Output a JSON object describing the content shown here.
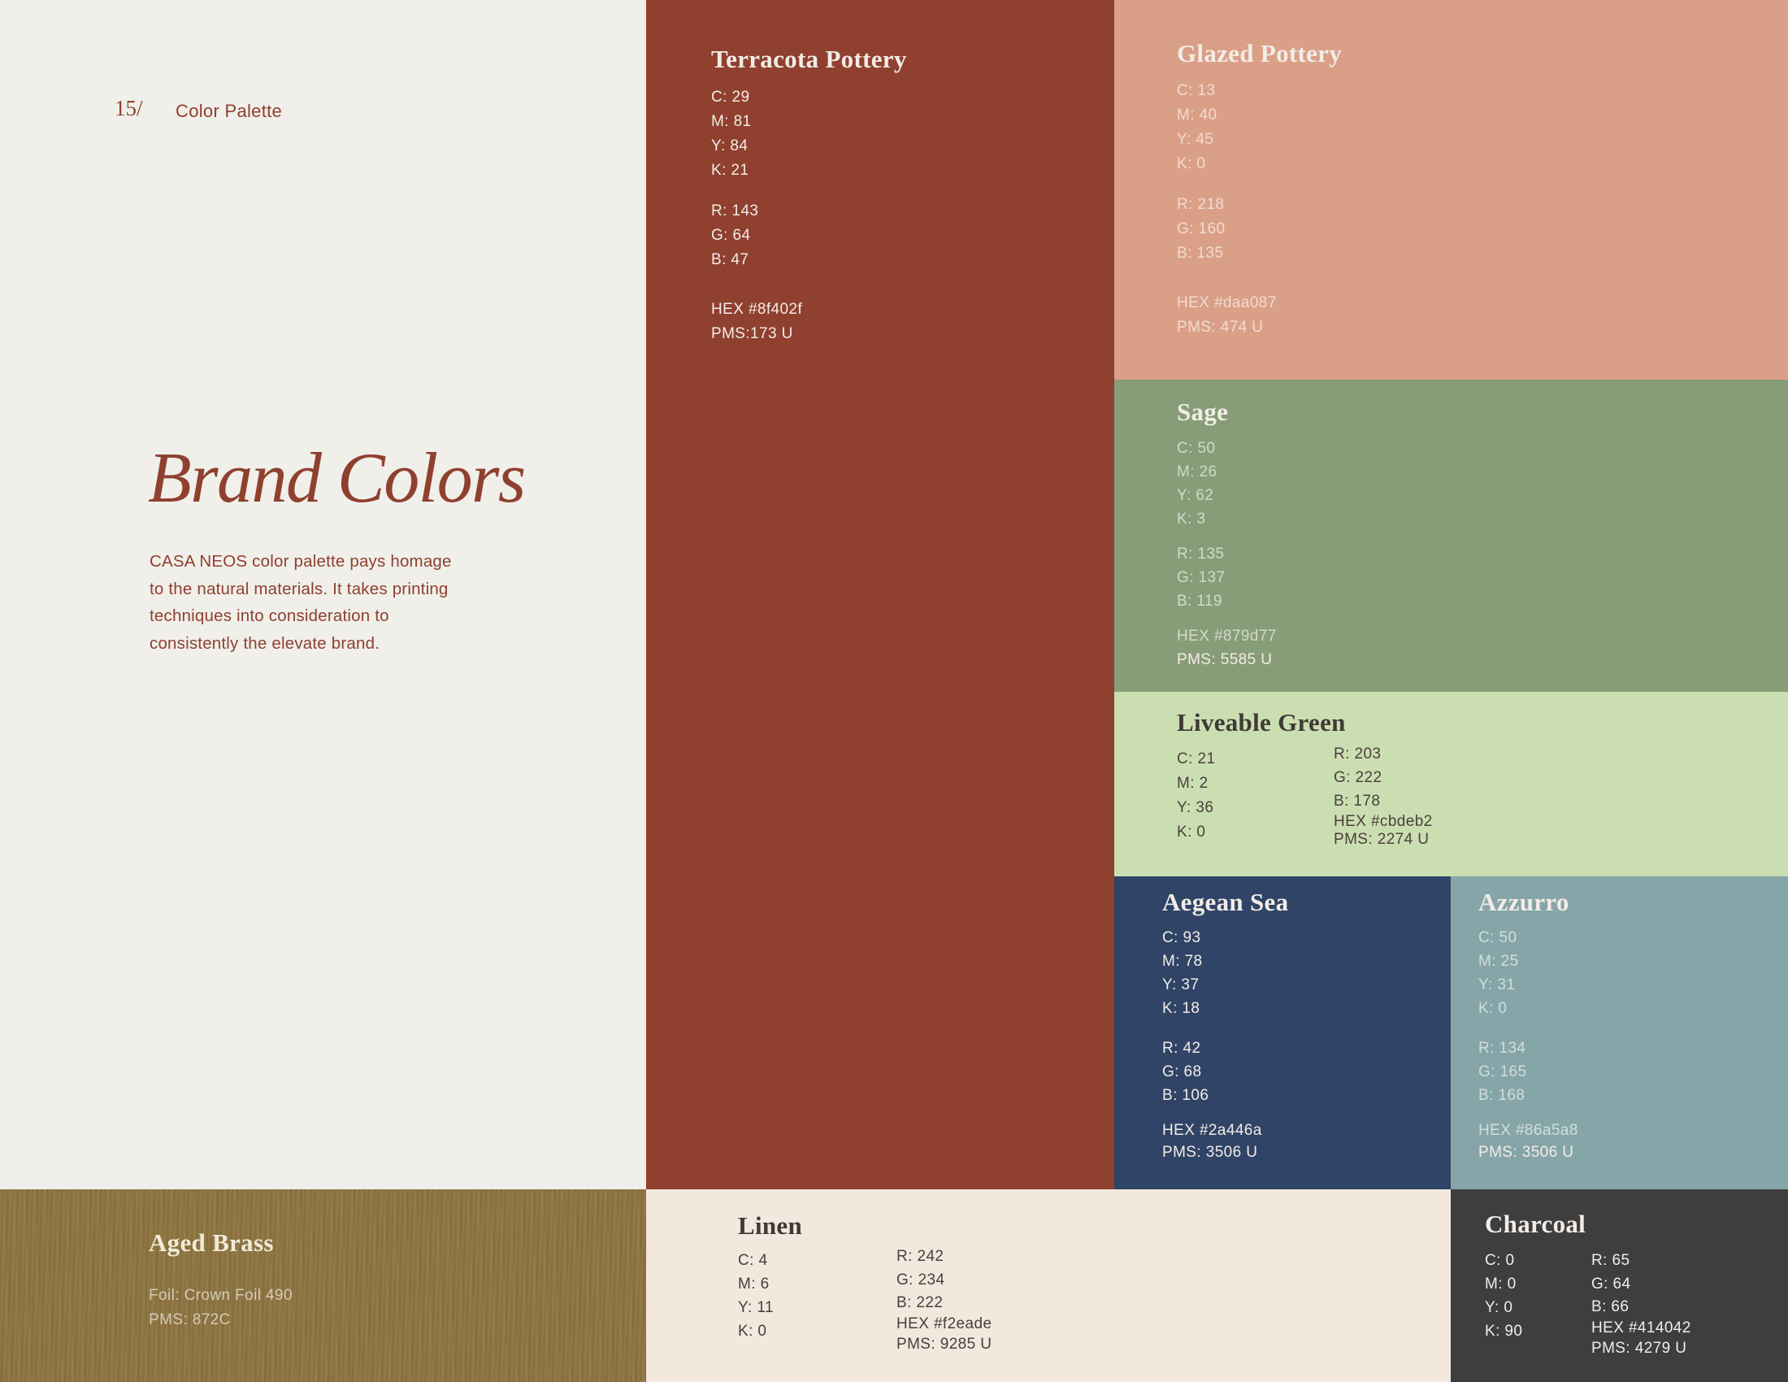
{
  "header": {
    "page_number": "15/",
    "section_title": "Color Palette"
  },
  "intro": {
    "title": "Brand Colors",
    "body_lines": [
      "CASA NEOS color palette pays homage",
      "to the natural materials. It takes printing",
      "techniques into consideration to",
      "consistently the elevate brand."
    ]
  },
  "colors": {
    "terracota": {
      "name": "Terracota Pottery",
      "swatch": "#8f402f",
      "cmyk": [
        "C: 29",
        "M: 81",
        "Y: 84",
        "K: 21"
      ],
      "rgb": [
        "R: 143",
        "G: 64",
        "B: 47"
      ],
      "hex": "HEX #8f402f",
      "pms": "PMS:173 U"
    },
    "glazed": {
      "name": "Glazed Pottery",
      "swatch": "#daa087",
      "cmyk": [
        "C: 13",
        "M: 40",
        "Y: 45",
        "K: 0"
      ],
      "rgb": [
        "R: 218",
        "G: 160",
        "B: 135"
      ],
      "hex": "HEX #daa087",
      "pms": "PMS: 474 U"
    },
    "sage": {
      "name": "Sage",
      "swatch": "#879d77",
      "cmyk": [
        "C: 50",
        "M: 26",
        "Y: 62",
        "K: 3"
      ],
      "rgb": [
        "R: 135",
        "G: 137",
        "B: 119"
      ],
      "hex": "HEX #879d77",
      "pms": "PMS: 5585 U"
    },
    "liveable": {
      "name": "Liveable Green",
      "swatch": "#cbdeb2",
      "cmyk": [
        "C: 21",
        "M: 2",
        "Y: 36",
        "K: 0"
      ],
      "rgb": [
        "R: 203",
        "G: 222",
        "B: 178"
      ],
      "hex": "HEX #cbdeb2",
      "pms": "PMS: 2274 U"
    },
    "aegean": {
      "name": "Aegean Sea",
      "swatch": "#2a446a",
      "cmyk": [
        "C: 93",
        "M: 78",
        "Y: 37",
        "K: 18"
      ],
      "rgb": [
        "R: 42",
        "G: 68",
        "B: 106"
      ],
      "hex": "HEX #2a446a",
      "pms": "PMS: 3506 U"
    },
    "azzurro": {
      "name": "Azzurro",
      "swatch": "#86a5a8",
      "cmyk": [
        "C: 50",
        "M: 25",
        "Y: 31",
        "K: 0"
      ],
      "rgb": [
        "R: 134",
        "G: 165",
        "B: 168"
      ],
      "hex": "HEX #86a5a8",
      "pms": "PMS: 3506 U"
    },
    "brass": {
      "name": "Aged Brass",
      "swatch": "#8e7440",
      "foil": "Foil: Crown Foil 490",
      "pms": "PMS: 872C"
    },
    "linen": {
      "name": "Linen",
      "swatch": "#f2eade",
      "cmyk": [
        "C: 4",
        "M: 6",
        "Y: 11",
        "K: 0"
      ],
      "rgb": [
        "R: 242",
        "G: 234",
        "B: 222"
      ],
      "hex": "HEX #f2eade",
      "pms": "PMS: 9285 U"
    },
    "charcoal": {
      "name": "Charcoal",
      "swatch": "#414042",
      "cmyk": [
        "C: 0",
        "M: 0",
        "Y: 0",
        "K: 90"
      ],
      "rgb": [
        "R: 65",
        "G: 64",
        "B: 66"
      ],
      "hex": "HEX #414042",
      "pms": "PMS: 4279 U"
    }
  }
}
